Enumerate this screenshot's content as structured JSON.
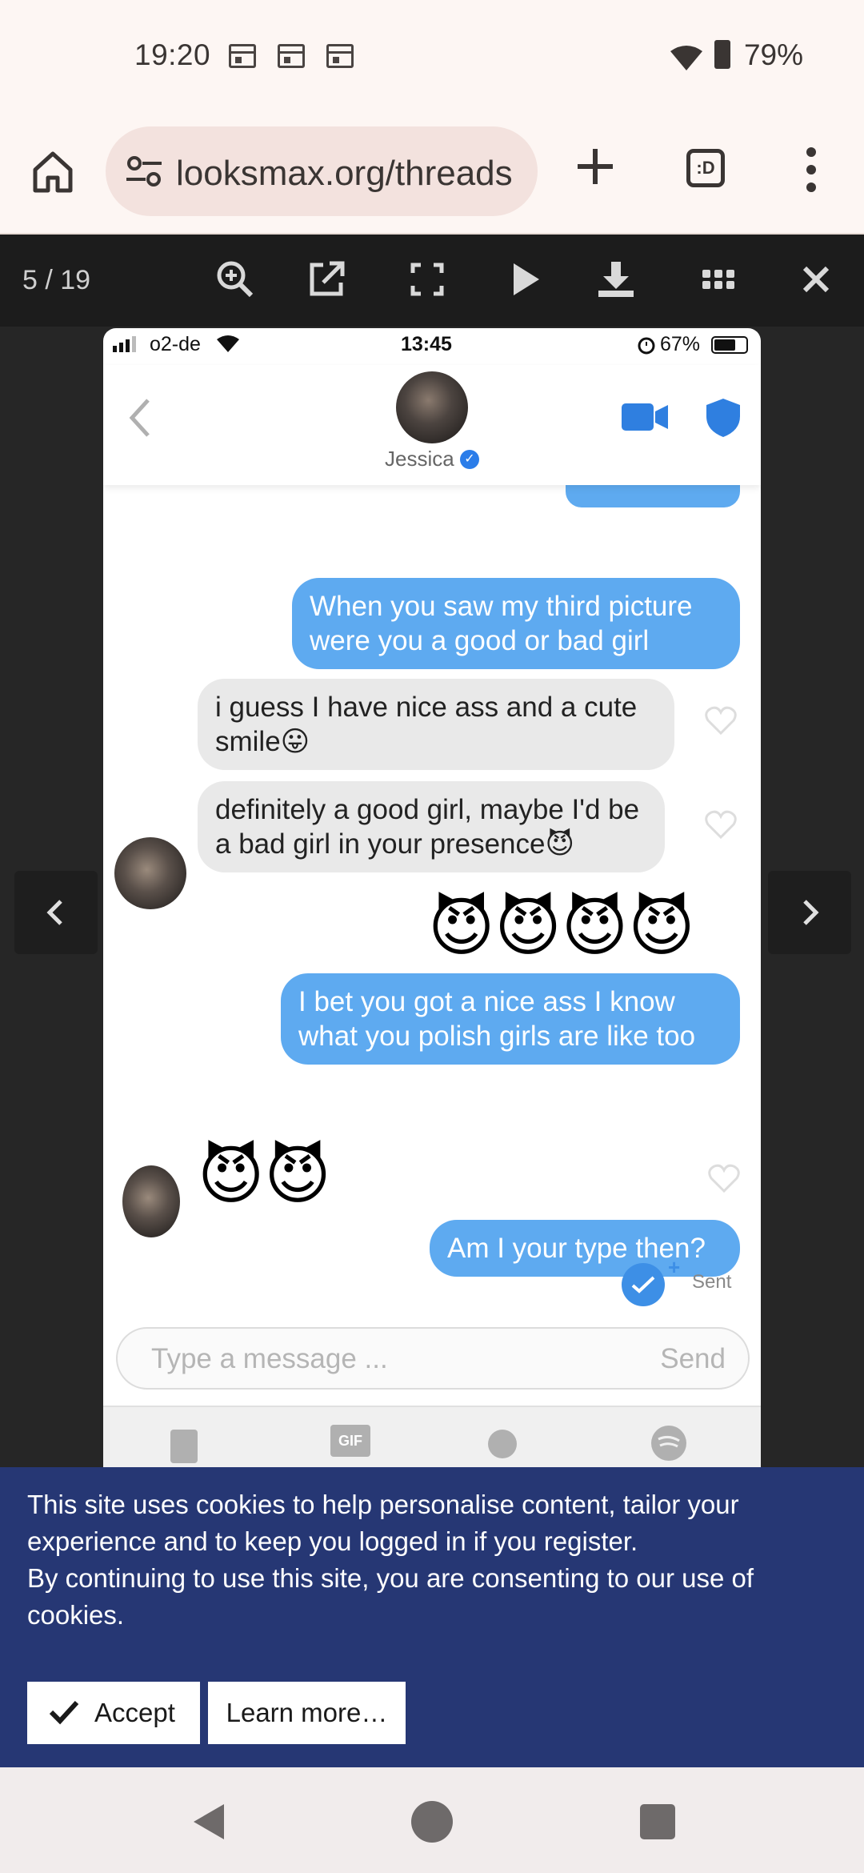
{
  "status_bar": {
    "time": "19:20",
    "battery": "79%"
  },
  "browser": {
    "url": "looksmax.org/threads",
    "tab_label": ":D"
  },
  "lightbox": {
    "counter": "5 / 19"
  },
  "screenshot": {
    "carrier": "o2-de",
    "time": "13:45",
    "battery": "67%",
    "contact_name": "Jessica",
    "messages": [
      {
        "from": "me",
        "text": "When you saw my third picture were you a good or bad girl"
      },
      {
        "from": "them",
        "text": "i guess I have nice ass and a cute smile😛"
      },
      {
        "from": "them",
        "text": "definitely a good girl, maybe I'd be a bad girl in your presence😈"
      },
      {
        "from": "me",
        "emoji": "😈😈😈😈"
      },
      {
        "from": "me",
        "text": "I bet you got a nice ass I know what you polish girls are like too"
      },
      {
        "from": "them",
        "emoji": "😈😈"
      },
      {
        "from": "me",
        "text": "Am I your type then?"
      }
    ],
    "sent_label": "Sent",
    "composer_placeholder": "Type a message ...",
    "composer_send": "Send",
    "gif_label": "GIF"
  },
  "cookie_banner": {
    "text_line1": "This site uses cookies to help personalise content, tailor your experience and to keep you logged in if you register.",
    "text_line2": "By continuing to use this site, you are consenting to our use of cookies.",
    "accept_label": "Accept",
    "learn_more_label": "Learn more…"
  },
  "colors": {
    "accent": "#5eaaf0",
    "banner": "#263774",
    "devil": "#8e44c9"
  }
}
